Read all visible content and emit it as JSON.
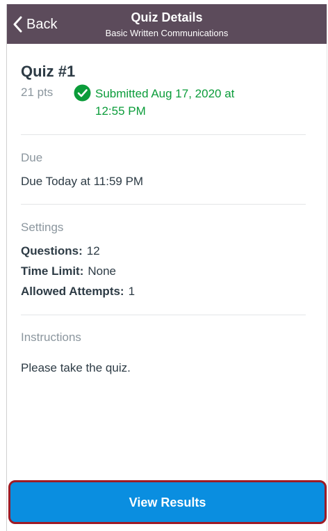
{
  "header": {
    "back_label": "Back",
    "title": "Quiz Details",
    "subtitle": "Basic Written Communications"
  },
  "quiz": {
    "title": "Quiz #1",
    "points": "21 pts",
    "submitted_line1": "Submitted Aug 17, 2020 at",
    "submitted_line2": "12:55 PM"
  },
  "due": {
    "label": "Due",
    "value": "Due Today at 11:59 PM"
  },
  "settings": {
    "label": "Settings",
    "items": [
      {
        "key": "Questions:",
        "value": "12"
      },
      {
        "key": "Time Limit:",
        "value": "None"
      },
      {
        "key": "Allowed Attempts:",
        "value": "1"
      }
    ]
  },
  "instructions": {
    "label": "Instructions",
    "value": "Please take the quiz."
  },
  "actions": {
    "view_results_label": "View Results"
  },
  "colors": {
    "header_bg": "#5c4b5b",
    "submitted_green": "#0b9c3a",
    "button_blue": "#0a8ee0",
    "highlight_red": "#9e1b26"
  }
}
